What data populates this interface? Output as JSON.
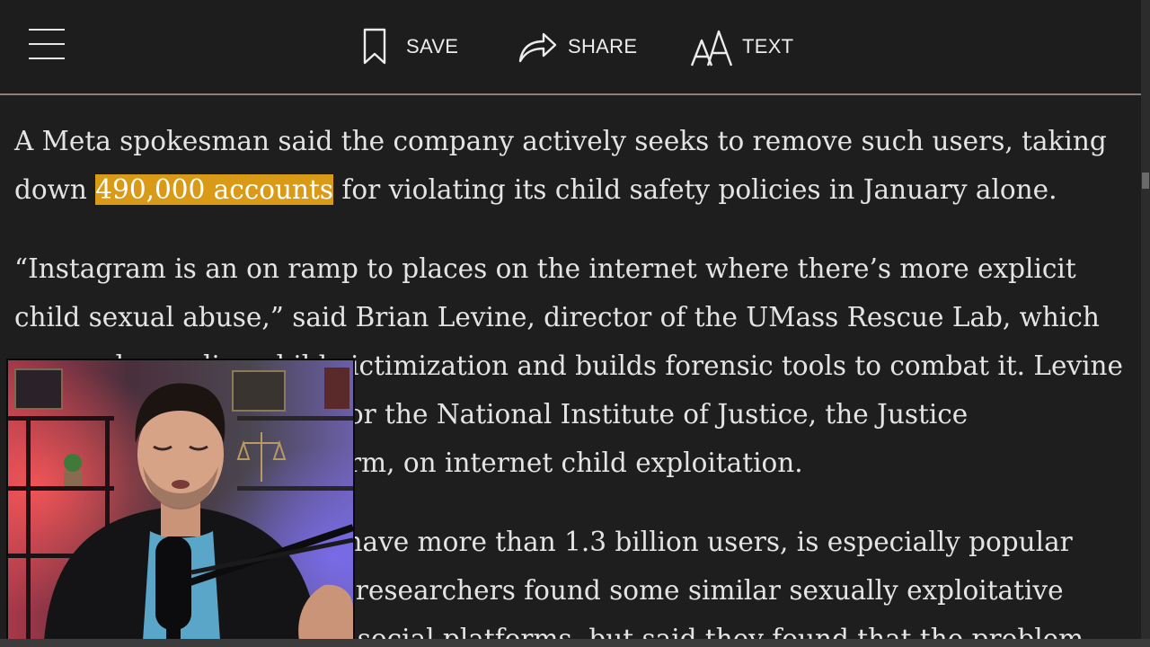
{
  "toolbar": {
    "menu_icon": "hamburger-menu-icon",
    "save_label": "SAVE",
    "save_icon": "bookmark-icon",
    "share_label": "SHARE",
    "share_icon": "share-arrow-icon",
    "text_label": "TEXT",
    "text_icon": "text-size-icon"
  },
  "article": {
    "p1_before": "A Meta spokesman said the company actively seeks to remove such users, taking down ",
    "p1_highlight": "490,000 accounts",
    "p1_after": " for violating its child safety policies in January alone.",
    "p2": "“Instagram is an on ramp to places on the internet where there’s more explicit child sexual abuse,” said Brian Levine, director of the UMass Rescue Lab, which researches online child victimization and builds forensic tools to combat it. Levine authored a 2022 report for the National Institute of Justice, the Justice Department’s research arm, on internet child exploitation.",
    "p3": "Instagram, estimated to have more than 1.3 billion users, is especially popular with teens. The Stanford researchers found some similar sexually exploitative activity on other, smaller social platforms, but said they found that the problem"
  },
  "colors": {
    "background": "#1e1e1e",
    "highlight": "#d89a17",
    "toolbar_border": "#8a8175",
    "text": "#e4e4e4"
  }
}
